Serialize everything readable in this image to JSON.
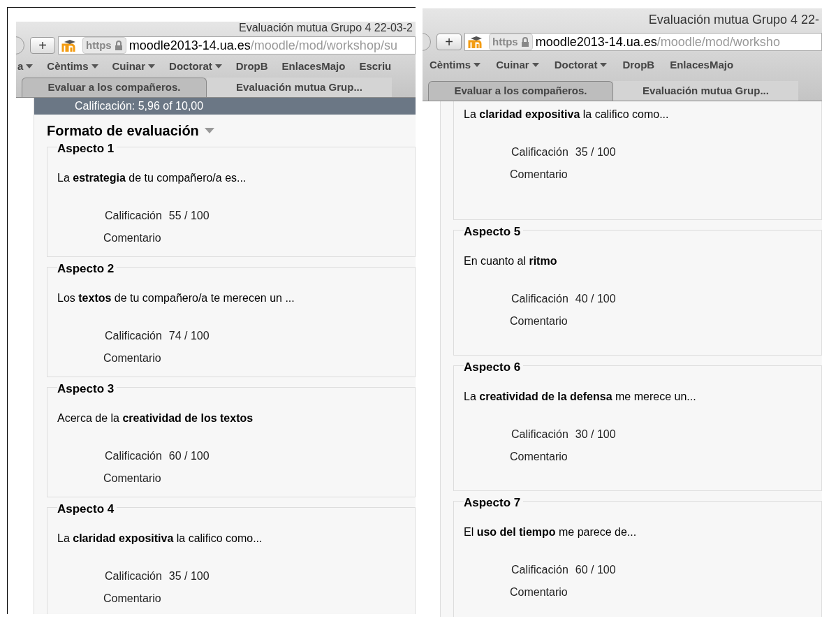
{
  "panels": [
    {
      "browser": {
        "new_tab": "+",
        "title": "Evaluación mutua Grupo 4 22-03-2",
        "url_host": "moodle2013-14.ua.es",
        "url_path": "/moodle/mod/workshop/su",
        "https": "https",
        "bookmarks": [
          {
            "label": "a",
            "menu": true
          },
          {
            "label": "Cèntims",
            "menu": true
          },
          {
            "label": "Cuinar",
            "menu": true
          },
          {
            "label": "Doctorat",
            "menu": true
          },
          {
            "label": "DropB",
            "menu": false
          },
          {
            "label": "EnlacesMajo",
            "menu": false
          },
          {
            "label": "Escriu",
            "menu": false
          }
        ],
        "tabs": [
          {
            "label": "Evaluar a los compañeros.",
            "selected": false
          },
          {
            "label": "Evaluación mutua Grup...",
            "selected": true
          }
        ]
      },
      "grade_banner": "Calificación: 5,96 of 10,00",
      "section_title": "Formato de evaluación",
      "aspects": [
        {
          "legend": "Aspecto 1",
          "prompt": "La **estrategia** de tu compañero/a es...",
          "grade_label": "Calificación",
          "grade": "55 / 100",
          "comment_label": "Comentario"
        },
        {
          "legend": "Aspecto 2",
          "prompt": "Los **textos** de tu compañero/a te merecen un ...",
          "grade_label": "Calificación",
          "grade": "74 / 100",
          "comment_label": "Comentario"
        },
        {
          "legend": "Aspecto 3",
          "prompt": "Acerca de la **creatividad de los textos**",
          "grade_label": "Calificación",
          "grade": "60 / 100",
          "comment_label": "Comentario"
        },
        {
          "legend": "Aspecto 4",
          "prompt": "La **claridad expositiva** la califico como...",
          "grade_label": "Calificación",
          "grade": "35 / 100",
          "comment_label": "Comentario"
        }
      ]
    },
    {
      "browser": {
        "new_tab": "+",
        "title": "Evaluación mutua Grupo 4 22-",
        "url_host": "moodle2013-14.ua.es",
        "url_path": "/moodle/mod/worksho",
        "https": "https",
        "bookmarks": [
          {
            "label": "Cèntims",
            "menu": true
          },
          {
            "label": "Cuinar",
            "menu": true
          },
          {
            "label": "Doctorat",
            "menu": true
          },
          {
            "label": "DropB",
            "menu": false
          },
          {
            "label": "EnlacesMajo",
            "menu": false
          }
        ],
        "tabs": [
          {
            "label": "Evaluar a los compañeros.",
            "selected": false
          },
          {
            "label": "Evaluación mutua Grup...",
            "selected": true
          }
        ]
      },
      "aspects": [
        {
          "prompt": "La **claridad expositiva** la califico como...",
          "grade_label": "Calificación",
          "grade": "35 / 100",
          "comment_label": "Comentario"
        },
        {
          "legend": "Aspecto 5",
          "prompt": "En cuanto al **ritmo**",
          "grade_label": "Calificación",
          "grade": "40 / 100",
          "comment_label": "Comentario"
        },
        {
          "legend": "Aspecto 6",
          "prompt": "La **creatividad de la defensa** me merece un...",
          "grade_label": "Calificación",
          "grade": "30 / 100",
          "comment_label": "Comentario"
        },
        {
          "legend": "Aspecto 7",
          "prompt": "El **uso del tiempo** me parece de...",
          "grade_label": "Calificación",
          "grade": "60 / 100",
          "comment_label": "Comentario"
        }
      ]
    }
  ]
}
